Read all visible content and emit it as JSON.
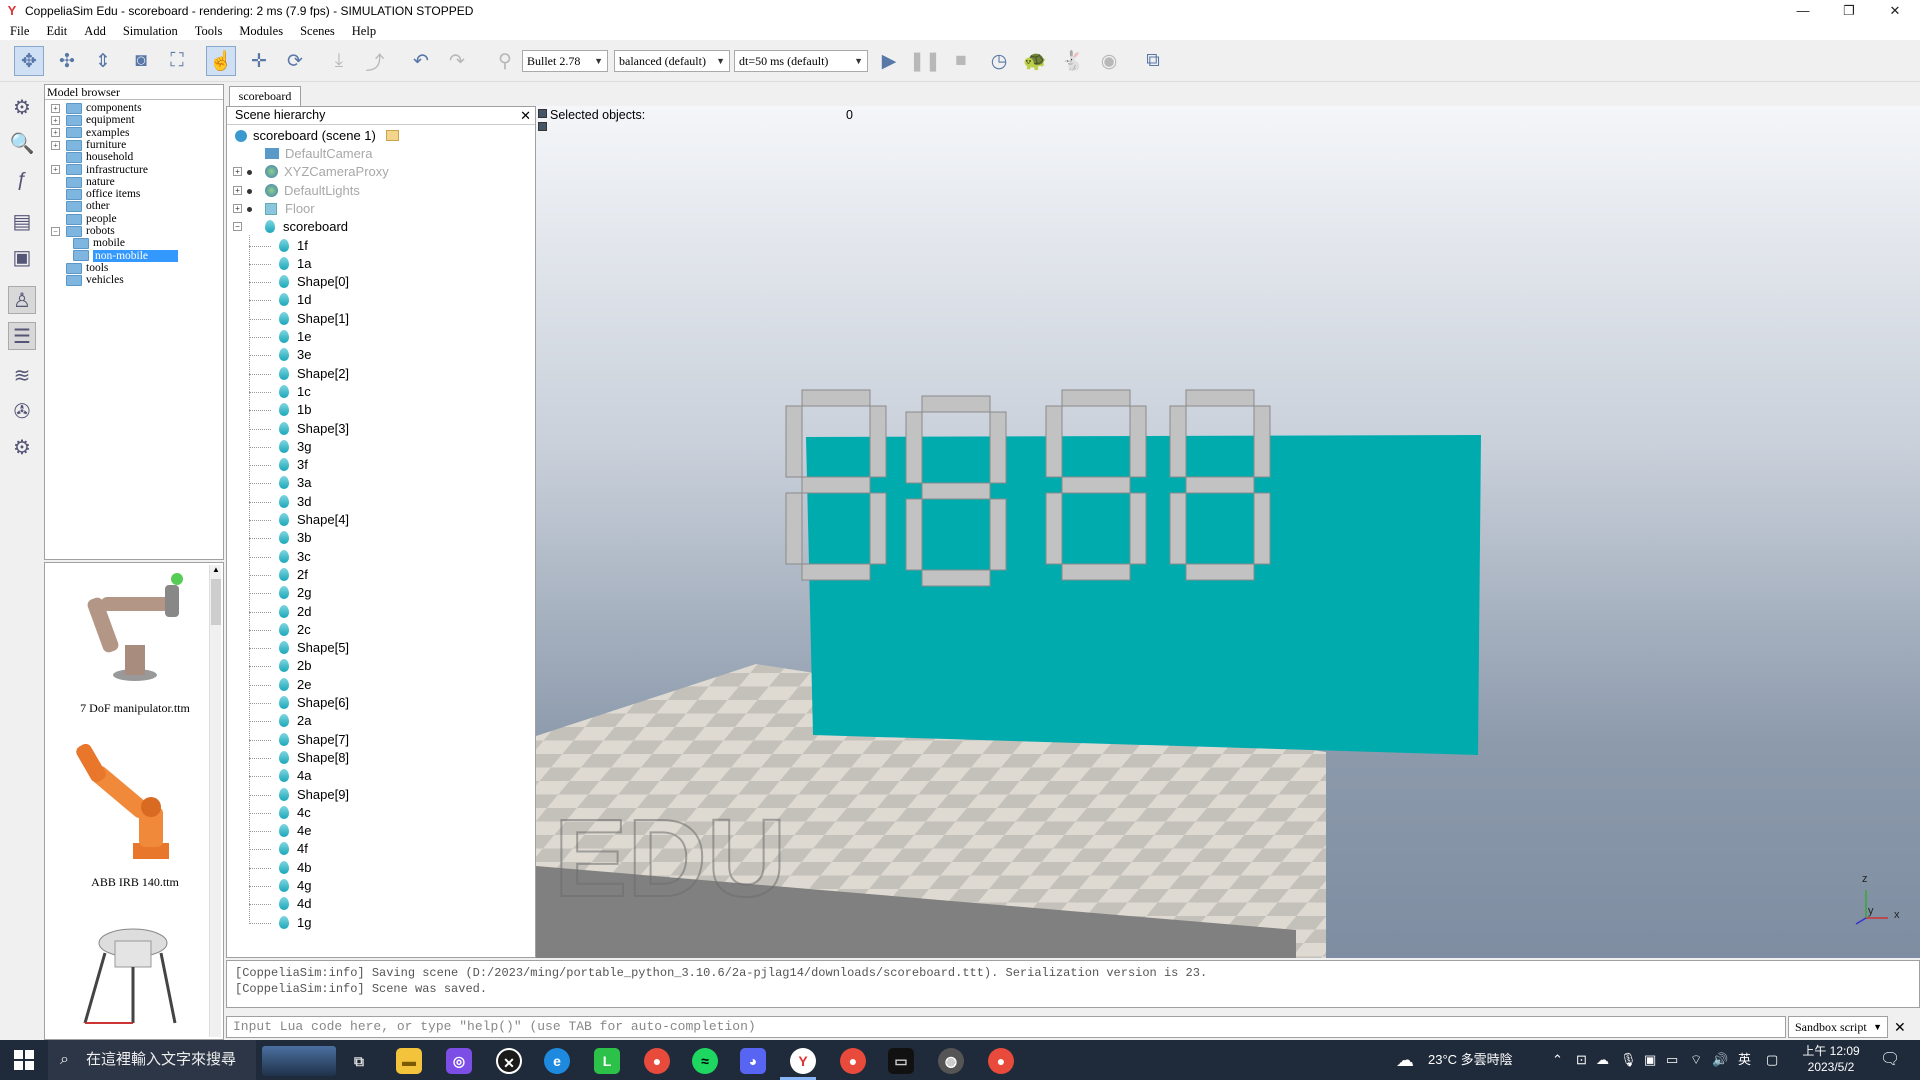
{
  "window": {
    "title": "CoppeliaSim Edu - scoreboard - rendering: 2 ms (7.9 fps) - SIMULATION STOPPED",
    "minimize": "—",
    "maximize": "❐",
    "close": "✕"
  },
  "menu": [
    "File",
    "Edit",
    "Add",
    "Simulation",
    "Tools",
    "Modules",
    "Scenes",
    "Help"
  ],
  "toolbar": {
    "engine": "Bullet 2.78",
    "accuracy": "balanced (default)",
    "dt": "dt=50 ms (default)"
  },
  "model_browser": {
    "title": "Model browser",
    "items": [
      {
        "label": "components",
        "expand": "+"
      },
      {
        "label": "equipment",
        "expand": "+"
      },
      {
        "label": "examples",
        "expand": "+"
      },
      {
        "label": "furniture",
        "expand": "+"
      },
      {
        "label": "household",
        "expand": ""
      },
      {
        "label": "infrastructure",
        "expand": "+"
      },
      {
        "label": "nature",
        "expand": ""
      },
      {
        "label": "office items",
        "expand": ""
      },
      {
        "label": "other",
        "expand": ""
      },
      {
        "label": "people",
        "expand": ""
      },
      {
        "label": "robots",
        "expand": "−"
      }
    ],
    "robot_children": [
      "mobile",
      "non-mobile"
    ],
    "tail_items": [
      "tools",
      "vehicles"
    ],
    "thumbnails": [
      "7 DoF manipulator.ttm",
      "ABB IRB 140.ttm"
    ]
  },
  "scene_tab": "scoreboard",
  "hierarchy": {
    "title": "Scene hierarchy",
    "close": "✕",
    "root": "scoreboard (scene 1)",
    "top_items": [
      "DefaultCamera",
      "XYZCameraProxy",
      "DefaultLights",
      "Floor",
      "scoreboard"
    ],
    "children": [
      "1f",
      "1a",
      "Shape[0]",
      "1d",
      "Shape[1]",
      "1e",
      "3e",
      "Shape[2]",
      "1c",
      "1b",
      "Shape[3]",
      "3g",
      "3f",
      "3a",
      "3d",
      "Shape[4]",
      "3b",
      "3c",
      "2f",
      "2g",
      "2d",
      "2c",
      "Shape[5]",
      "2b",
      "2e",
      "Shape[6]",
      "2a",
      "Shape[7]",
      "Shape[8]",
      "4a",
      "Shape[9]",
      "4c",
      "4e",
      "4f",
      "4b",
      "4g",
      "4d",
      "1g"
    ]
  },
  "viewport": {
    "selected_label": "Selected objects:",
    "selected_count": "0",
    "watermark": "EDU",
    "axis_z": "z",
    "axis_y": "y",
    "axis_x": "x",
    "panel_color": "#00abae"
  },
  "console": {
    "lines": [
      "[CoppeliaSim:info] Saving scene (D:/2023/ming/portable_python_3.10.6/2a-pjlag14/downloads/scoreboard.ttt). Serialization version is 23.",
      "[CoppeliaSim:info] Scene was saved."
    ]
  },
  "command": {
    "placeholder": "Input Lua code here, or type \"help()\" (use TAB for auto-completion)",
    "mode": "Sandbox script",
    "close": "✕"
  },
  "taskbar": {
    "search_placeholder": "在這裡輸入文字來搜尋",
    "weather": "23°C  多雲時陰",
    "ime": "英",
    "time": "上午 12:09",
    "date": "2023/5/2"
  }
}
